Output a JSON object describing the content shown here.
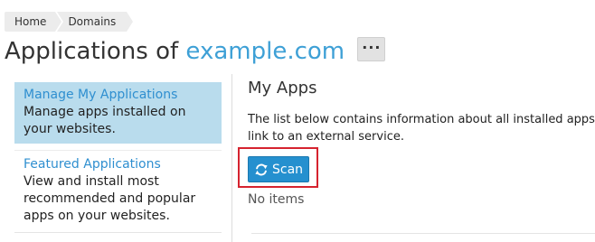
{
  "breadcrumb": {
    "items": [
      "Home",
      "Domains"
    ]
  },
  "header": {
    "title_prefix": "Applications of",
    "domain": "example.com",
    "more_label": "···"
  },
  "sidebar": {
    "items": [
      {
        "title": "Manage My Applications",
        "desc": "Manage apps installed on your websites.",
        "active": true
      },
      {
        "title": "Featured Applications",
        "desc": "View and install most recommended and popular apps on your websites.",
        "active": false
      }
    ]
  },
  "main": {
    "section_title": "My Apps",
    "intro_lines": [
      "The list below contains information about all installed apps.",
      "link to an external service."
    ],
    "scan_label": "Scan",
    "empty_text": "No items"
  },
  "colors": {
    "accent": "#2590cf",
    "link": "#2f8fd0",
    "active_bg": "#b9dced",
    "highlight": "#d6232f"
  },
  "icons": {
    "scan": "refresh-icon"
  }
}
